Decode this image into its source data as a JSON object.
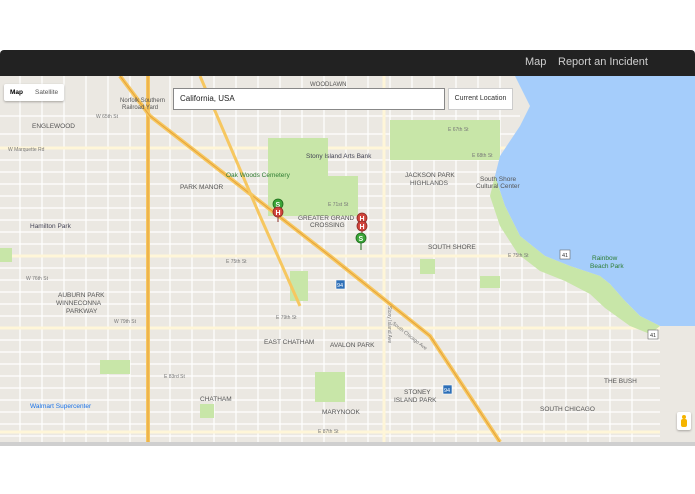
{
  "navbar": {
    "links": [
      "Map",
      "Report an Incident"
    ]
  },
  "map_controls": {
    "types": [
      "Map",
      "Satellite"
    ],
    "active": "Map"
  },
  "search": {
    "value": "California, USA"
  },
  "current_location_label": "Current Location",
  "labels": {
    "woodlawn": "WOODLAWN",
    "norfolk_1": "Norfolk Southern",
    "norfolk_2": "Railroad Yard",
    "englewood": "ENGLEWOOD",
    "stony_arts": "Stony Island Arts Bank",
    "oak_woods": "Oak Woods Cemetery",
    "jackson_1": "JACKSON PARK",
    "jackson_2": "HIGHLANDS",
    "south_shore_cc_1": "South Shore",
    "south_shore_cc_2": "Cultural Center",
    "park_manor": "PARK MANOR",
    "greater_grand_1": "GREATER GRAND",
    "greater_grand_2": "CROSSING",
    "hamilton_park": "Hamilton Park",
    "south_shore": "SOUTH SHORE",
    "rainbow_1": "Rainbow",
    "rainbow_2": "Beach Park",
    "auburn_1": "AUBURN PARK",
    "auburn_2": "WINNECONNA",
    "auburn_3": "PARKWAY",
    "east_chatham": "EAST CHATHAM",
    "avalon_park": "AVALON PARK",
    "chatham": "CHATHAM",
    "stoney_1": "STONEY",
    "stoney_2": "ISLAND PARK",
    "the_bush": "THE BUSH",
    "walmart": "Walmart Supercenter",
    "marynook": "MARYNOOK",
    "south_chicago": "SOUTH CHICAGO",
    "st_65": "W 65th St",
    "st_67": "E 67th St",
    "st_68": "E 68th St",
    "st_71": "E 71st St",
    "st_75": "E 75th St",
    "st_75b": "E 75th St",
    "st_76": "W 76th St",
    "st_79": "E 79th St",
    "st_79w": "W 79th St",
    "st_83": "E 83rd St",
    "st_87": "E 87th St",
    "marquette": "W Marquette Rd",
    "stony_ave": "Stony Island Ave",
    "south_chicago_ave": "South Chicago Ave",
    "hwy_41": "41",
    "i_94": "94"
  },
  "markers": [
    {
      "letter": "S",
      "color": "#3aa537"
    },
    {
      "letter": "H",
      "color": "#d0433b"
    },
    {
      "letter": "H",
      "color": "#d0433b"
    },
    {
      "letter": "H",
      "color": "#d0433b"
    },
    {
      "letter": "S",
      "color": "#3aa537"
    }
  ],
  "colors": {
    "water": "#a5cdfb",
    "park": "#c8e6a8",
    "highway": "#f6c760",
    "road": "#ffffff",
    "land": "#ebe8e2"
  }
}
